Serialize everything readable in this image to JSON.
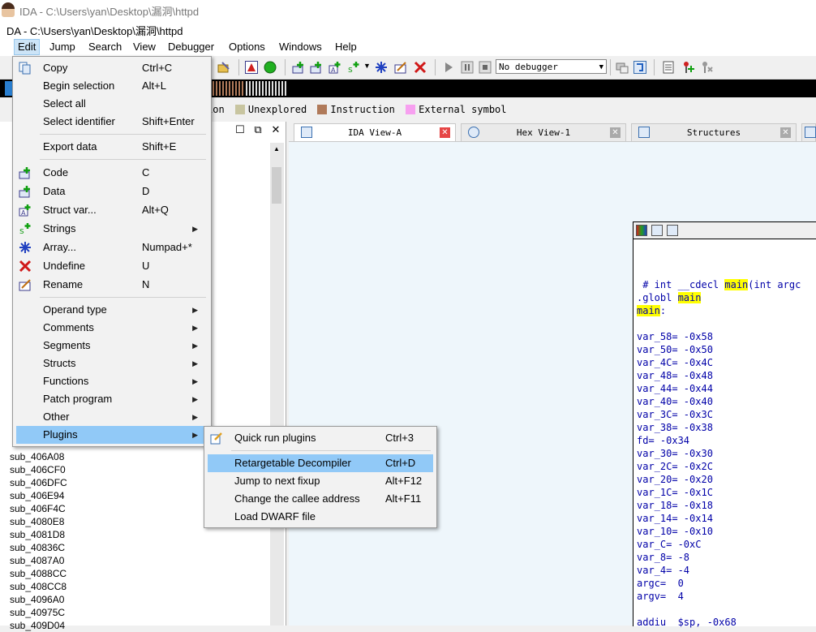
{
  "window": {
    "app_title": "IDA - C:\\Users\\yan\\Desktop\\漏洞\\httpd",
    "doc_title": "DA - C:\\Users\\yan\\Desktop\\漏洞\\httpd"
  },
  "menubar": [
    "Edit",
    "Jump",
    "Search",
    "View",
    "Debugger",
    "Options",
    "Windows",
    "Help"
  ],
  "toolbar": {
    "debugger_select": "No debugger"
  },
  "legend": [
    {
      "label": "ion",
      "color": null
    },
    {
      "label": "Unexplored",
      "color": "#c8c5a0"
    },
    {
      "label": "Instruction",
      "color": "#b07a5a"
    },
    {
      "label": "External symbol",
      "color": "#f7a0f0"
    }
  ],
  "left_panel": {
    "functions": [
      "sub_406A08",
      "sub_406CF0",
      "sub_406DFC",
      "sub_406E94",
      "sub_406F4C",
      "sub_4080E8",
      "sub_4081D8",
      "sub_40836C",
      "sub_4087A0",
      "sub_4088CC",
      "sub_408CC8",
      "sub_4096A0",
      "sub_40975C",
      "sub_409D04"
    ],
    "ctrl_close": "✕"
  },
  "tabs": [
    {
      "label": "IDA View-A",
      "active": true
    },
    {
      "label": "Hex View-1",
      "active": false
    },
    {
      "label": "Structures",
      "active": false
    }
  ],
  "code": {
    "line1_prefix": " # int __cdecl ",
    "line1_main": "main",
    "line1_suffix": "(int argc",
    "globl_prefix": ".globl ",
    "globl_main": "main",
    "label": "main",
    "label_colon": ":",
    "vars": [
      "var_58= -0x58",
      "var_50= -0x50",
      "var_4C= -0x4C",
      "var_48= -0x48",
      "var_44= -0x44",
      "var_40= -0x40",
      "var_3C= -0x3C",
      "var_38= -0x38",
      "fd= -0x34",
      "var_30= -0x30",
      "var_2C= -0x2C",
      "var_20= -0x20",
      "var_1C= -0x1C",
      "var_18= -0x18",
      "var_14= -0x14",
      "var_10= -0x10",
      "var_C= -0xC",
      "var_8= -8",
      "var_4= -4",
      "argc=  0",
      "argv=  4"
    ],
    "last_line": "addiu  $sp, -0x68"
  },
  "edit_menu": {
    "items": [
      {
        "label": "Copy",
        "shortcut": "Ctrl+C"
      },
      {
        "label": "Begin selection",
        "shortcut": "Alt+L"
      },
      {
        "label": "Select all",
        "shortcut": ""
      },
      {
        "label": "Select identifier",
        "shortcut": "Shift+Enter"
      },
      {
        "label": "Export data",
        "shortcut": "Shift+E"
      },
      {
        "label": "Code",
        "shortcut": "C"
      },
      {
        "label": "Data",
        "shortcut": "D"
      },
      {
        "label": "Struct var...",
        "shortcut": "Alt+Q"
      },
      {
        "label": "Strings",
        "shortcut": ""
      },
      {
        "label": "Array...",
        "shortcut": "Numpad+*"
      },
      {
        "label": "Undefine",
        "shortcut": "U"
      },
      {
        "label": "Rename",
        "shortcut": "N"
      },
      {
        "label": "Operand type",
        "shortcut": ""
      },
      {
        "label": "Comments",
        "shortcut": ""
      },
      {
        "label": "Segments",
        "shortcut": ""
      },
      {
        "label": "Structs",
        "shortcut": ""
      },
      {
        "label": "Functions",
        "shortcut": ""
      },
      {
        "label": "Patch program",
        "shortcut": ""
      },
      {
        "label": "Other",
        "shortcut": ""
      },
      {
        "label": "Plugins",
        "shortcut": ""
      }
    ],
    "submenu_arrow": "▶"
  },
  "plugins_menu": {
    "items": [
      {
        "label": "Quick run plugins",
        "shortcut": "Ctrl+3"
      },
      {
        "label": "Retargetable Decompiler",
        "shortcut": "Ctrl+D"
      },
      {
        "label": "Jump to next fixup",
        "shortcut": "Alt+F12"
      },
      {
        "label": "Change the callee address",
        "shortcut": "Alt+F11"
      },
      {
        "label": "Load DWARF file",
        "shortcut": ""
      }
    ]
  },
  "colors": {
    "menu_highlight": "#91c9f7",
    "code_text": "#0000a8",
    "name_highlight": "#ffff00",
    "graph_bg": "#eef6fb"
  }
}
